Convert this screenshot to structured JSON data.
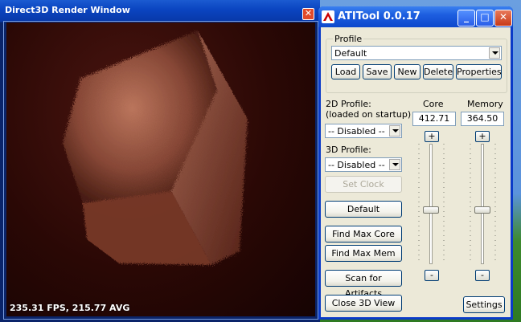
{
  "d3d_window": {
    "title": "Direct3D Render Window",
    "fps_text": "235.31 FPS, 215.77 AVG",
    "close_glyph": "✕"
  },
  "ati_window": {
    "title": "ATITool 0.0.17",
    "minimize_glyph": "_",
    "maximize_glyph": "□",
    "close_glyph": "✕",
    "profile": {
      "legend": "Profile",
      "selected": "Default",
      "buttons": {
        "load": "Load",
        "save": "Save",
        "new": "New",
        "delete": "Delete",
        "properties": "Properties"
      }
    },
    "profile_2d": {
      "label_line1": "2D Profile:",
      "label_line2": "(loaded on startup)",
      "selected": "-- Disabled --"
    },
    "profile_3d": {
      "label": "3D Profile:",
      "selected": "-- Disabled --"
    },
    "core": {
      "label": "Core",
      "value": "412.71",
      "plus": "+",
      "minus": "-",
      "level": 0.45
    },
    "memory": {
      "label": "Memory",
      "value": "364.50",
      "plus": "+",
      "minus": "-",
      "level": 0.45
    },
    "buttons": {
      "set_clock": "Set Clock",
      "default": "Default",
      "find_max_core": "Find Max Core",
      "find_max_mem": "Find Max Mem",
      "scan_artifacts": "Scan for Artifacts",
      "close_3d": "Close 3D View",
      "settings": "Settings"
    }
  }
}
